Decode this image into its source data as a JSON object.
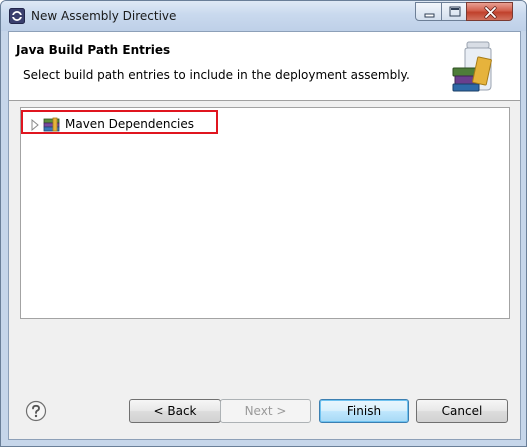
{
  "window": {
    "title": "New Assembly Directive"
  },
  "header": {
    "title": "Java Build Path Entries",
    "description": "Select build path entries to include in the deployment assembly."
  },
  "tree": {
    "items": [
      {
        "label": "Maven Dependencies",
        "icon": "library-icon",
        "expanded": false
      }
    ]
  },
  "buttons": {
    "back": "< Back",
    "next": "Next >",
    "finish": "Finish",
    "cancel": "Cancel"
  },
  "colors": {
    "highlight_box": "#e0151f",
    "default_button_border": "#3c7fb1"
  }
}
